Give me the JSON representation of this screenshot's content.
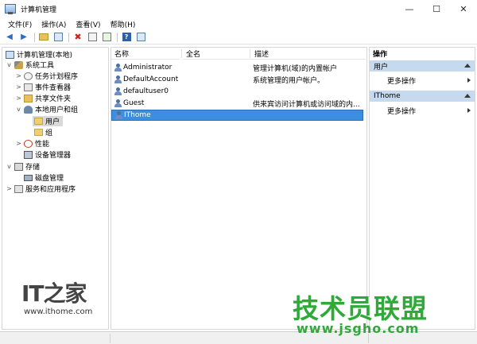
{
  "window": {
    "title": "计算机管理",
    "controls": {
      "minimize": "—",
      "maximize": "☐",
      "close": "✕"
    }
  },
  "menu": [
    "文件(F)",
    "操作(A)",
    "查看(V)",
    "帮助(H)"
  ],
  "toolbar": {
    "back": "◀",
    "forward": "▶",
    "delete": "✖"
  },
  "tree": {
    "root": "计算机管理(本地)",
    "system_tools": "系统工具",
    "task_scheduler": "任务计划程序",
    "event_viewer": "事件查看器",
    "shared_folders": "共享文件夹",
    "local_users": "本地用户和组",
    "users": "用户",
    "groups": "组",
    "performance": "性能",
    "device_manager": "设备管理器",
    "storage": "存储",
    "disk_management": "磁盘管理",
    "services": "服务和应用程序",
    "expand_glyph": ">",
    "collapse_glyph": "v"
  },
  "list": {
    "columns": [
      "名称",
      "全名",
      "描述"
    ],
    "rows": [
      {
        "name": "Administrator",
        "full_name": "",
        "description": "管理计算机(域)的内置帐户"
      },
      {
        "name": "DefaultAccount",
        "full_name": "",
        "description": "系统管理的用户帐户。"
      },
      {
        "name": "defaultuser0",
        "full_name": "",
        "description": ""
      },
      {
        "name": "Guest",
        "full_name": "",
        "description": "供来宾访问计算机或访问域的内..."
      },
      {
        "name": "IThome",
        "full_name": "",
        "description": ""
      }
    ],
    "selected_row": "IThome"
  },
  "actions": {
    "header": "操作",
    "sections": [
      {
        "title": "用户",
        "item": "更多操作"
      },
      {
        "title": "IThome",
        "item": "更多操作"
      }
    ]
  },
  "watermarks": {
    "it_logo": "IT之家",
    "it_url": "www.ithome.com",
    "site_logo": "技术员联盟",
    "site_url": "www.jsgho.com",
    "site_color": "#2faa3a"
  },
  "colors": {
    "selection": "#3b8ee0",
    "action_section": "#c6d9ee"
  }
}
